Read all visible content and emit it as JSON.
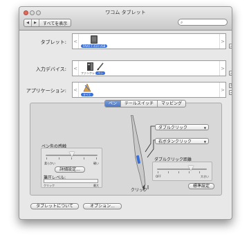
{
  "window": {
    "title": "ワコム タブレット",
    "show_all": "すべてを表示",
    "search_placeholder": ""
  },
  "rows": {
    "tablet": {
      "label": "タブレット:",
      "item_label": "FAVO F-410 USB"
    },
    "input_device": {
      "label": "入力デバイス:",
      "items": [
        "ファンクション",
        "ペン"
      ]
    },
    "application": {
      "label": "アプリケーション:",
      "item_label": "すべて"
    }
  },
  "tabs": [
    "ペン",
    "テールスイッチ",
    "マッピング"
  ],
  "active_tab": 0,
  "pen": {
    "feel_title": "ペン先の感触",
    "soft": "柔らかい",
    "hard": "硬い",
    "feel_level": 0.5,
    "details_button": "詳細設定...",
    "pressure_title": "筆圧レベル:",
    "click": "クリック",
    "max": "最大",
    "button_top": "ダブルクリック",
    "button_side": "右ボタンクリック",
    "tip_label": "クリック",
    "dbl_title": "ダブルクリック距離",
    "off": "OFF",
    "large": "大きい",
    "dbl_level": 0.68,
    "default_button": "標準設定"
  },
  "footer": {
    "about_button": "タブレットについて",
    "options_button": "オプション..."
  },
  "nav": {
    "back": "◀",
    "forward": "▶"
  },
  "glyphs": {
    "left": "<",
    "right": ">",
    "plus": "+",
    "minus": "−",
    "caret": "▼",
    "search": "⌕"
  },
  "colors": {
    "accent": "#3a6fd8",
    "tab_active": "#4a78c8"
  }
}
